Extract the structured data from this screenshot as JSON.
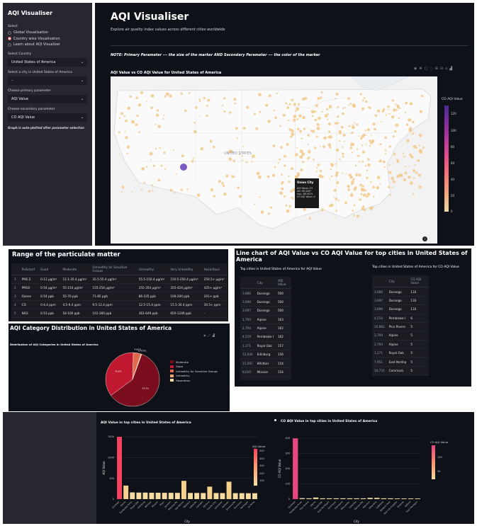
{
  "sidebar": {
    "title": "AQI Visualiser",
    "select_label": "Select",
    "radio_options": [
      {
        "label": "Global Visualisation",
        "selected": false
      },
      {
        "label": "Country wise Visualisation",
        "selected": true
      },
      {
        "label": "Learn about AQI Visualizer",
        "selected": false
      }
    ],
    "country_label": "Select Country",
    "country_value": "United States of America",
    "city_label": "Select a city in United States of America",
    "city_value": "-",
    "primary_label": "Choose primary parameter",
    "primary_value": "AQI Value",
    "secondary_label": "Choose secondary parameter",
    "secondary_value": "CO AQI Value",
    "note": "Graph is auto-plotted after parameter selection"
  },
  "main": {
    "title": "AQI Visualiser",
    "subtitle": "Explore air quality index values across different cities worldwide",
    "note": "NOTE: Primary Parameter --- the size of the marker AND Secondary Parameter --- the color of the marker",
    "map_title": "AQI Value vs CO AQI Value for United States of America",
    "map_label": "UNITED STATES",
    "tooltip": {
      "title": "Union City",
      "lines": [
        "AQI Value=73",
        "lat=36.4267",
        "lng=-88.9474",
        "CO AQI Value=2"
      ]
    },
    "colorbar": {
      "title": "CO AQI Value",
      "ticks": [
        "120",
        "100",
        "80",
        "60",
        "40",
        "20",
        "0"
      ]
    }
  },
  "range_section": {
    "title": "Range of the particulate matter",
    "headers": [
      "",
      "Pollutant",
      "Good",
      "Moderate",
      "Unhealthy for Sensitive Groups",
      "Unhealthy",
      "Very Unhealthy",
      "Hazardous"
    ],
    "rows": [
      [
        "1",
        "PM2.5",
        "0-12 µg/m³",
        "12.1-35.4 µg/m³",
        "35.5-55.4 µg/m³",
        "55.5-150.4 µg/m³",
        "150.5-250.4 µg/m³",
        "250.5+ µg/m³"
      ],
      [
        "2",
        "PM10",
        "0-54 µg/m³",
        "55-154 µg/m³",
        "155-254 µg/m³",
        "255-354 µg/m³",
        "355-424 µg/m³",
        "425+ µg/m³"
      ],
      [
        "3",
        "Ozone",
        "0-54 ppb",
        "55-70 ppb",
        "71-85 ppb",
        "86-105 ppb",
        "106-200 ppb",
        "201+ ppb"
      ],
      [
        "4",
        "CO",
        "0-4.4 ppm",
        "4.5-9.4 ppm",
        "9.5-12.4 ppm",
        "12.5-15.4 ppm",
        "15.5-30.4 ppm",
        "30.5+ ppm"
      ],
      [
        "5",
        "NO2",
        "0-53 ppb",
        "54-100 ppb",
        "101-360 ppb",
        "361-649 ppb",
        "650-1249 ppb",
        "-"
      ]
    ]
  },
  "category_section": {
    "title": "AQI Category Distribution in United States of America",
    "chart_title": "Distribution of AQI Categories in United States of America",
    "chart_data": {
      "type": "pie",
      "labels": [
        "Moderate",
        "Good",
        "Unhealthy for Sensitive Groups",
        "Unhealthy",
        "Hazardous"
      ],
      "values": [
        59.3,
        35.6,
        4.62,
        0.475,
        0.0
      ],
      "slice_labels": [
        "59.3%",
        "35.6%",
        "4.62%",
        "0.475%",
        ""
      ],
      "colors": [
        "#7a0d1e",
        "#c0182f",
        "#e06a4e",
        "#f0a370",
        "#f7d7a2"
      ]
    }
  },
  "line_section": {
    "title": "Line chart of AQI Value vs CO AQI Value for top cities in United States of America",
    "aqi_table": {
      "title": "Top cities in United States of America for AQI Value",
      "headers": [
        "",
        "City",
        "AQI Value"
      ],
      "rows": [
        [
          "3,686",
          "Durango",
          "500"
        ],
        [
          "3,696",
          "Durango",
          "500"
        ],
        [
          "3,697",
          "Durango",
          "500"
        ],
        [
          "1,793",
          "Alpine",
          "163"
        ],
        [
          "2,794",
          "Alpine",
          "162"
        ],
        [
          "4,519",
          "Pembroke I",
          "162"
        ],
        [
          "1,271",
          "Royal Oak",
          "157"
        ],
        [
          "12,026",
          "Edinburg",
          "156"
        ],
        [
          "15,097",
          "Whittier",
          "154"
        ],
        [
          "8,020",
          "Mission",
          "154"
        ]
      ]
    },
    "co_table": {
      "title": "Top cities in United States of America for CO AQI Value",
      "headers": [
        "",
        "City",
        "CO AQI Value"
      ],
      "rows": [
        [
          "3,686",
          "Durango",
          "133"
        ],
        [
          "3,697",
          "Durango",
          "133"
        ],
        [
          "3,696",
          "Durango",
          "133"
        ],
        [
          "4,519",
          "Pembroke I",
          "6"
        ],
        [
          "10,883",
          "Pico Rivera",
          "5"
        ],
        [
          "2,794",
          "Alpine",
          "5"
        ],
        [
          "2,793",
          "Alpine",
          "5"
        ],
        [
          "1,271",
          "Royal Oak",
          "5"
        ],
        [
          "7,951",
          "East Northp",
          "5"
        ],
        [
          "10,731",
          "Commack",
          "5"
        ]
      ]
    }
  },
  "bottom": {
    "aqi_chart": {
      "title": "AQI Value in top cities in United States of America",
      "xlabel": "City",
      "ylabel": "AQI Value",
      "colorbar_title": "AQI Value",
      "colorbar_ticks": [
        "500",
        "400",
        "300",
        "200",
        "100"
      ]
    },
    "co_chart": {
      "title": "CO AQI Value in top cities in United States of America",
      "xlabel": "City",
      "ylabel": "CO AQI Value",
      "colorbar_title": "CO AQI Value",
      "colorbar_ticks": [
        "100",
        "50"
      ]
    }
  },
  "chart_data": [
    {
      "type": "bar",
      "title": "AQI Value in top cities in United States of America",
      "xlabel": "City",
      "ylabel": "AQI Value",
      "ylim": [
        0,
        1500
      ],
      "yticks": [
        "0",
        "500",
        "1000",
        "1500"
      ],
      "categories": [
        "Durango",
        "Alpine",
        "Pembroke Pines",
        "Royal Oak",
        "Edinburg",
        "Whittier",
        "Mission",
        "Pharr",
        "Jackson",
        "Mooresville",
        "San Benito",
        "Weslaco",
        "Lakeside",
        "Camden",
        "Ventura",
        "Cavite City",
        "Lancaster",
        "Hollister",
        "Brownsville",
        "Gunnison",
        "Harlingen",
        "La Porte"
      ],
      "values": [
        1500,
        325,
        162,
        157,
        156,
        154,
        154,
        152,
        151,
        150,
        440,
        149,
        148,
        147,
        300,
        146,
        145,
        420,
        144,
        143,
        142,
        141
      ]
    },
    {
      "type": "bar",
      "title": "CO AQI Value in top cities in United States of America",
      "xlabel": "City",
      "ylabel": "CO AQI Value",
      "ylim": [
        0,
        400
      ],
      "yticks": [
        "0",
        "100",
        "200",
        "300",
        "400"
      ],
      "categories": [
        "Durango",
        "Pembroke Pines",
        "Pico Rivera",
        "Alpine",
        "Royal Oak",
        "East Northport",
        "Commack",
        "Glenwood",
        "Gloucester",
        "Colombo",
        "Gainesville",
        "Paterson",
        "Alhambra",
        "Lakeland",
        "Baldwin Park",
        "East Los Angeles",
        "Orlando",
        "Upland",
        "East Flanagan"
      ],
      "values": [
        399,
        6,
        5,
        10,
        5,
        5,
        5,
        5,
        5,
        5,
        5,
        8,
        8,
        5,
        5,
        4,
        4,
        4,
        4
      ]
    }
  ]
}
